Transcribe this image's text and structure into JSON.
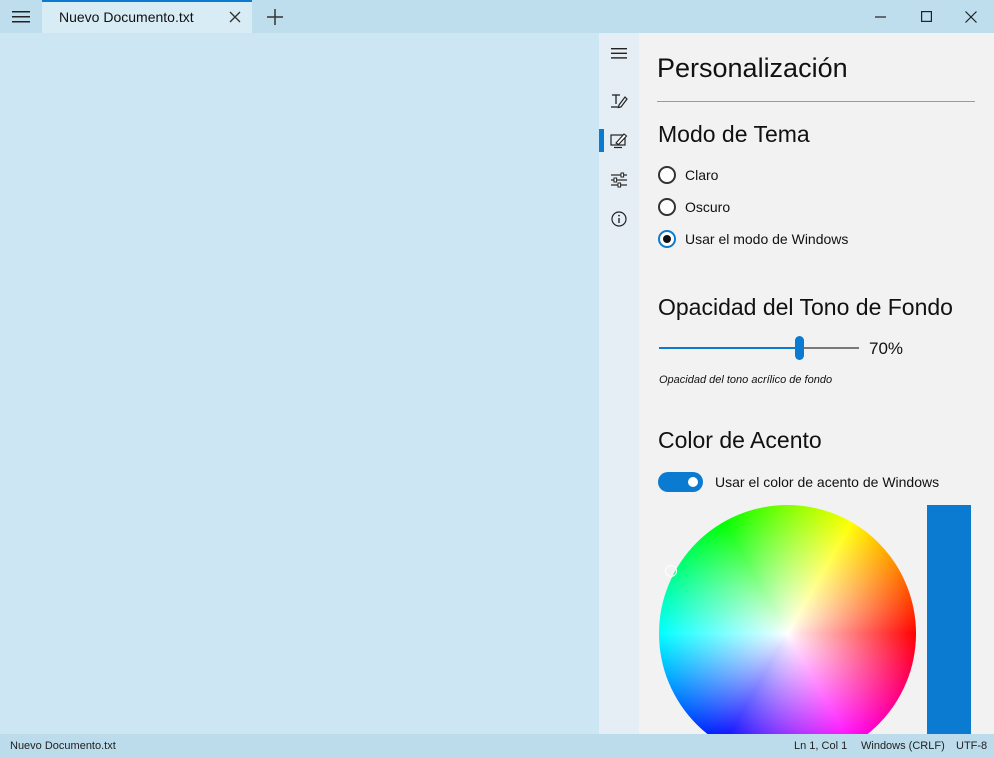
{
  "titlebar": {
    "tab_title": "Nuevo Documento.txt"
  },
  "icons": {
    "menu": "hamburger-icon",
    "close_tab": "close-icon",
    "add_tab": "plus-icon",
    "minimize": "minimize-icon",
    "maximize": "maximize-icon",
    "close_window": "close-icon",
    "nav_menu": "hamburger-icon",
    "nav_text": "text-edit-icon",
    "nav_personalization": "personalization-icon",
    "nav_advanced": "sliders-icon",
    "nav_about": "info-icon"
  },
  "settings": {
    "title": "Personalización",
    "theme": {
      "title": "Modo de Tema",
      "options": [
        "Claro",
        "Oscuro",
        "Usar el modo de Windows"
      ],
      "selected": "Usar el modo de Windows"
    },
    "opacity": {
      "title": "Opacidad del Tono de Fondo",
      "value": 70,
      "value_label": "70%",
      "caption": "Opacidad del tono acrílico de fondo"
    },
    "accent": {
      "title": "Color de Acento",
      "toggle_label": "Usar el color de acento de Windows",
      "toggle_on": true,
      "color": "#0b7ad1"
    }
  },
  "statusbar": {
    "file": "Nuevo Documento.txt",
    "position": "Ln 1, Col 1",
    "line_ending": "Windows (CRLF)",
    "encoding": "UTF-8"
  },
  "colors": {
    "accent": "#0b7ad1",
    "editor_bg": "#cde6f3",
    "titlebar_bg": "#bedded",
    "panel_bg": "#f2f2f2"
  }
}
